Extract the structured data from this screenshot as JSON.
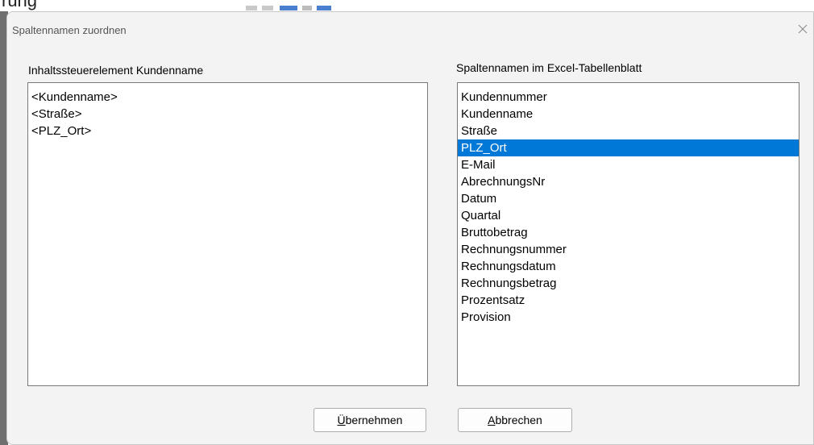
{
  "window": {
    "title": "Spaltennamen zuordnen"
  },
  "background": {
    "partial_text": "rung"
  },
  "left_panel": {
    "label": "Inhaltssteuerelement Kundenname",
    "items": [
      "<Kundenname>",
      "<Straße>",
      "<PLZ_Ort>"
    ]
  },
  "right_panel": {
    "label": "Spaltennamen im Excel-Tabellenblatt",
    "selected_index": 3,
    "items": [
      "Kundennummer",
      "Kundenname",
      "Straße",
      "PLZ_Ort",
      "E-Mail",
      "AbrechnungsNr",
      "Datum",
      "Quartal",
      "Bruttobetrag",
      "Rechnungsnummer",
      "Rechnungsdatum",
      "Rechnungsbetrag",
      "Prozentsatz",
      "Provision"
    ]
  },
  "buttons": {
    "apply_mnemonic": "Ü",
    "apply_rest": "bernehmen",
    "cancel_mnemonic": "A",
    "cancel_rest": "bbrechen"
  },
  "colors": {
    "selection": "#0078d7",
    "dialog_bg": "#f3f3f3"
  },
  "icons": {
    "close": "close-icon"
  }
}
